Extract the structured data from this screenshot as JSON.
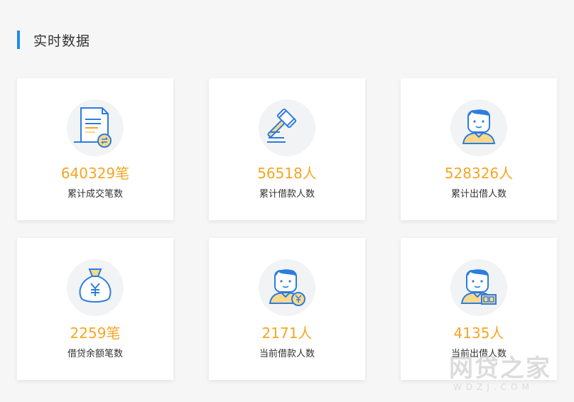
{
  "section": {
    "title": "实时数据"
  },
  "cards": [
    {
      "value": "640329笔",
      "label": "累计成交笔数",
      "icon": "contract-document-icon"
    },
    {
      "value": "56518人",
      "label": "累计借款人数",
      "icon": "gavel-icon"
    },
    {
      "value": "528326人",
      "label": "累计出借人数",
      "icon": "person-icon"
    },
    {
      "value": "2259笔",
      "label": "借贷余额笔数",
      "icon": "money-bag-icon"
    },
    {
      "value": "2171人",
      "label": "当前借款人数",
      "icon": "person-with-coin-icon"
    },
    {
      "value": "4135人",
      "label": "当前出借人数",
      "icon": "person-with-cash-icon"
    }
  ],
  "watermark": {
    "main": "网贷之家",
    "sub": "WDZJ.COM"
  },
  "colors": {
    "accent": "#1e8be6",
    "value": "#f5a623",
    "icon_fill": "#fbd88a"
  }
}
